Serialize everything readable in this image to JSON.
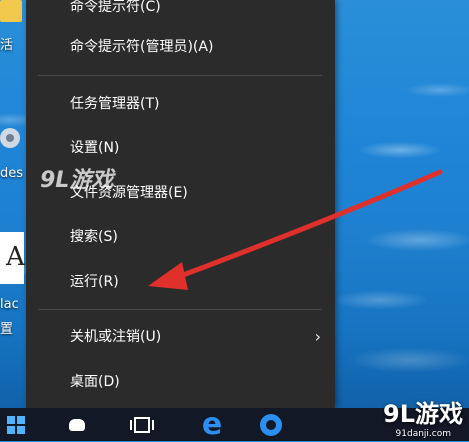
{
  "menu": {
    "items": [
      {
        "label": "命令提示符(C)"
      },
      {
        "label": "命令提示符(管理员)(A)"
      },
      {
        "label": "任务管理器(T)"
      },
      {
        "label": "设置(N)"
      },
      {
        "label": "文件资源管理器(E)"
      },
      {
        "label": "搜索(S)"
      },
      {
        "label": "运行(R)"
      },
      {
        "label": "关机或注销(U)",
        "chevron": "›"
      },
      {
        "label": "桌面(D)"
      }
    ]
  },
  "desktop": {
    "labels": [
      "活",
      "des",
      "lac",
      "置"
    ]
  },
  "taskbar": {
    "icons": [
      "windows-start-icon",
      "search-icon",
      "task-view-icon",
      "edge-icon",
      "store-icon"
    ]
  },
  "watermark": {
    "brand": "9L游戏",
    "url": "91danji.com",
    "center": "9L游戏"
  },
  "colors": {
    "menu_bg": "#2b2b2b",
    "arrow": "#e0302c",
    "taskbar": "#121826"
  }
}
